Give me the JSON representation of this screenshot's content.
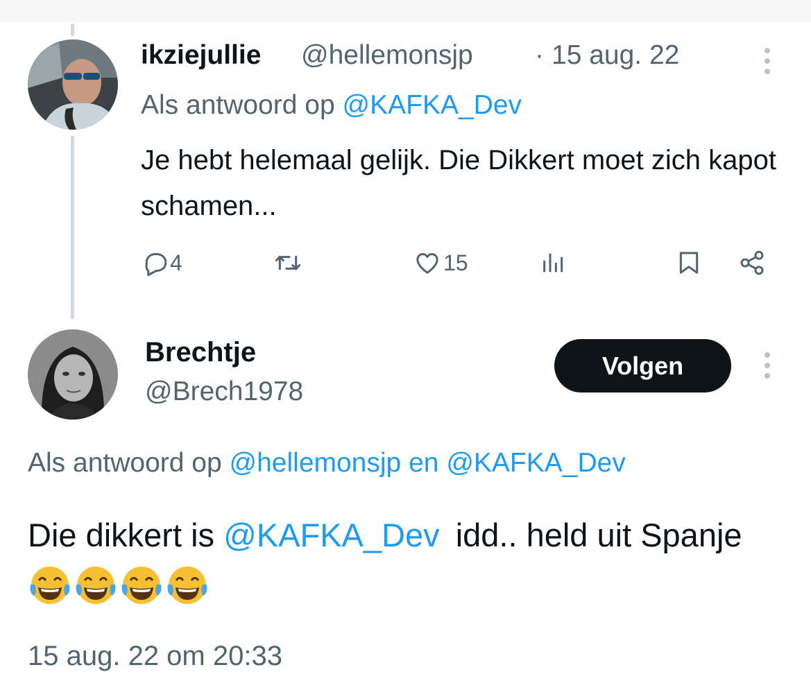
{
  "tweet1": {
    "display_name": "ikziejullie",
    "handle": "@hellemonsjp",
    "separator": "·",
    "date": "15 aug. 22",
    "reply_prefix": "Als antwoord op",
    "reply_mention": "@KAFKA_Dev",
    "text": "Je hebt helemaal gelijk. Die Dikkert moet zich kapot schamen...",
    "replies_count": "4",
    "likes_count": "15"
  },
  "tweet2": {
    "display_name": "Brechtje",
    "handle": "@Brech1978",
    "follow_label": "Volgen",
    "reply_prefix": "Als antwoord op",
    "reply_mention1": "@hellemonsjp",
    "reply_conjunction": "en",
    "reply_mention2": "@KAFKA_Dev",
    "text_part1": "Die dikkert is",
    "text_mention": "@KAFKA_Dev",
    "text_part2": "idd.. held uit Spanje",
    "emoji": [
      "face-with-tears-of-joy",
      "face-with-tears-of-joy",
      "face-with-tears-of-joy",
      "face-with-tears-of-joy"
    ],
    "timestamp": "15 aug. 22 om 20:33"
  },
  "icons": [
    "reply-icon",
    "retweet-icon",
    "like-icon",
    "views-icon",
    "bookmark-icon",
    "share-icon",
    "more-options-icon"
  ],
  "colors": {
    "text": "#0f1419",
    "secondary": "#536471",
    "link": "#1d9bf0",
    "button_bg": "#0f1419",
    "button_text": "#ffffff",
    "thread_line": "#cfd9de"
  }
}
